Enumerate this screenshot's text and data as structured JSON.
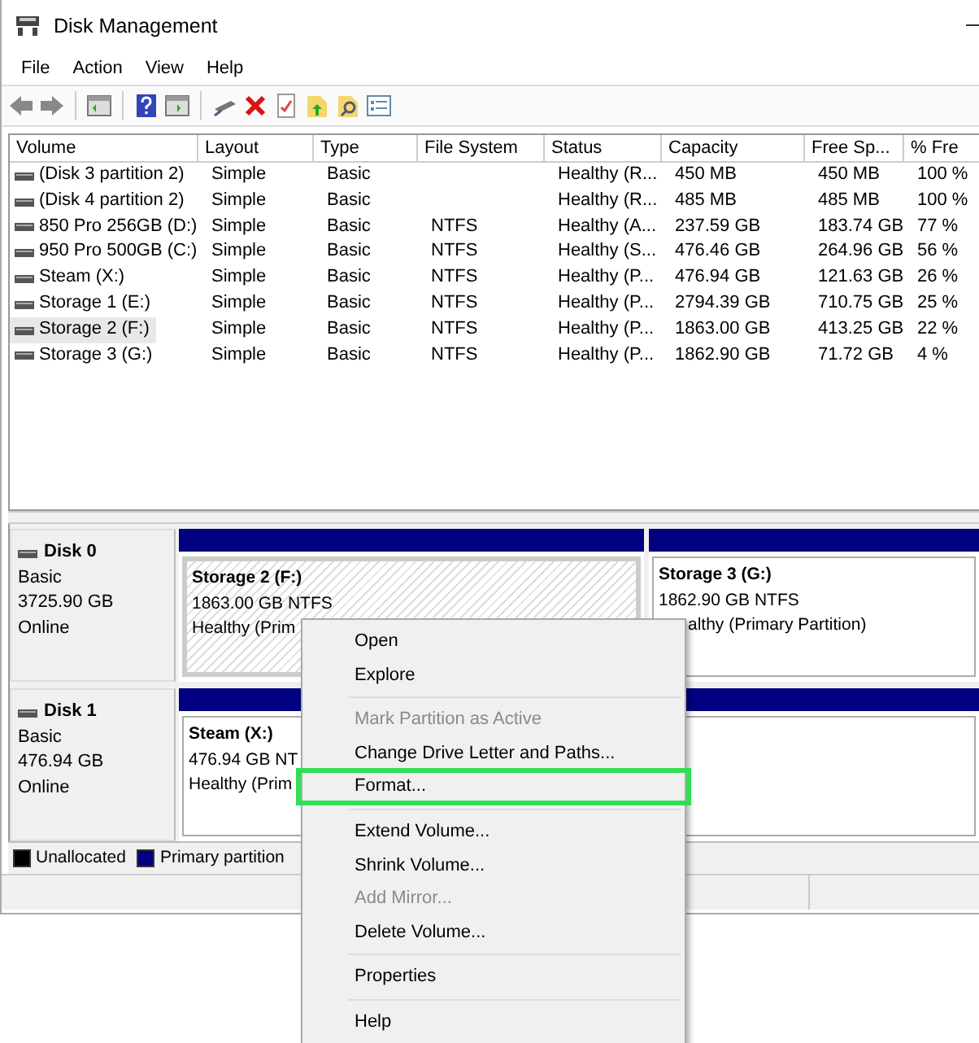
{
  "window": {
    "title": "Disk Management"
  },
  "menu": [
    "File",
    "Action",
    "View",
    "Help"
  ],
  "table": {
    "columns": [
      "Volume",
      "Layout",
      "Type",
      "File System",
      "Status",
      "Capacity",
      "Free Sp...",
      "% Fre"
    ],
    "rows": [
      {
        "selected": false,
        "cells": [
          "(Disk 3 partition 2)",
          "Simple",
          "Basic",
          "",
          "Healthy (R...",
          "450 MB",
          "450 MB",
          "100 %"
        ]
      },
      {
        "selected": false,
        "cells": [
          "(Disk 4 partition 2)",
          "Simple",
          "Basic",
          "",
          "Healthy (R...",
          "485 MB",
          "485 MB",
          "100 %"
        ]
      },
      {
        "selected": false,
        "cells": [
          "850 Pro 256GB (D:)",
          "Simple",
          "Basic",
          "NTFS",
          "Healthy (A...",
          "237.59 GB",
          "183.74 GB",
          "77 %"
        ]
      },
      {
        "selected": false,
        "cells": [
          "950 Pro 500GB (C:)",
          "Simple",
          "Basic",
          "NTFS",
          "Healthy (S...",
          "476.46 GB",
          "264.96 GB",
          "56 %"
        ]
      },
      {
        "selected": false,
        "cells": [
          "Steam (X:)",
          "Simple",
          "Basic",
          "NTFS",
          "Healthy (P...",
          "476.94 GB",
          "121.63 GB",
          "26 %"
        ]
      },
      {
        "selected": false,
        "cells": [
          "Storage 1 (E:)",
          "Simple",
          "Basic",
          "NTFS",
          "Healthy (P...",
          "2794.39 GB",
          "710.75 GB",
          "25 %"
        ]
      },
      {
        "selected": true,
        "cells": [
          "Storage 2 (F:)",
          "Simple",
          "Basic",
          "NTFS",
          "Healthy (P...",
          "1863.00 GB",
          "413.25 GB",
          "22 %"
        ]
      },
      {
        "selected": false,
        "cells": [
          "Storage 3 (G:)",
          "Simple",
          "Basic",
          "NTFS",
          "Healthy (P...",
          "1862.90 GB",
          "71.72 GB",
          "4 %"
        ]
      }
    ]
  },
  "disks": [
    {
      "name": "Disk 0",
      "lines": [
        "Basic",
        "3725.90 GB",
        "Online"
      ],
      "partitions": [
        {
          "title": "Storage 2  (F:)",
          "lines": [
            "1863.00 GB NTFS",
            "Healthy (Prim"
          ],
          "selected": true
        },
        {
          "title": "Storage 3  (G:)",
          "lines": [
            "1862.90 GB NTFS",
            "althy (Primary Partition)"
          ],
          "selected": false
        }
      ]
    },
    {
      "name": "Disk 1",
      "lines": [
        "Basic",
        "476.94 GB",
        "Online"
      ],
      "partitions": [
        {
          "title": "Steam  (X:)",
          "lines": [
            "476.94 GB NT",
            "Healthy (Prim"
          ],
          "selected": false
        }
      ]
    }
  ],
  "legend": [
    {
      "label": "Unallocated",
      "color": "#000000"
    },
    {
      "label": "Primary partition",
      "color": "#000080"
    }
  ],
  "context_menu": [
    {
      "kind": "item",
      "label": "Open",
      "disabled": false,
      "highlighted": false
    },
    {
      "kind": "item",
      "label": "Explore",
      "disabled": false,
      "highlighted": false
    },
    {
      "kind": "separator"
    },
    {
      "kind": "item",
      "label": "Mark Partition as Active",
      "disabled": true,
      "highlighted": false
    },
    {
      "kind": "item",
      "label": "Change Drive Letter and Paths...",
      "disabled": false,
      "highlighted": false
    },
    {
      "kind": "item",
      "label": "Format...",
      "disabled": false,
      "highlighted": true
    },
    {
      "kind": "separator"
    },
    {
      "kind": "item",
      "label": "Extend Volume...",
      "disabled": false,
      "highlighted": false
    },
    {
      "kind": "item",
      "label": "Shrink Volume...",
      "disabled": false,
      "highlighted": false
    },
    {
      "kind": "item",
      "label": "Add Mirror...",
      "disabled": true,
      "highlighted": false
    },
    {
      "kind": "item",
      "label": "Delete Volume...",
      "disabled": false,
      "highlighted": false
    },
    {
      "kind": "separator"
    },
    {
      "kind": "item",
      "label": "Properties",
      "disabled": false,
      "highlighted": false
    },
    {
      "kind": "separator"
    },
    {
      "kind": "item",
      "label": "Help",
      "disabled": false,
      "highlighted": false
    }
  ]
}
